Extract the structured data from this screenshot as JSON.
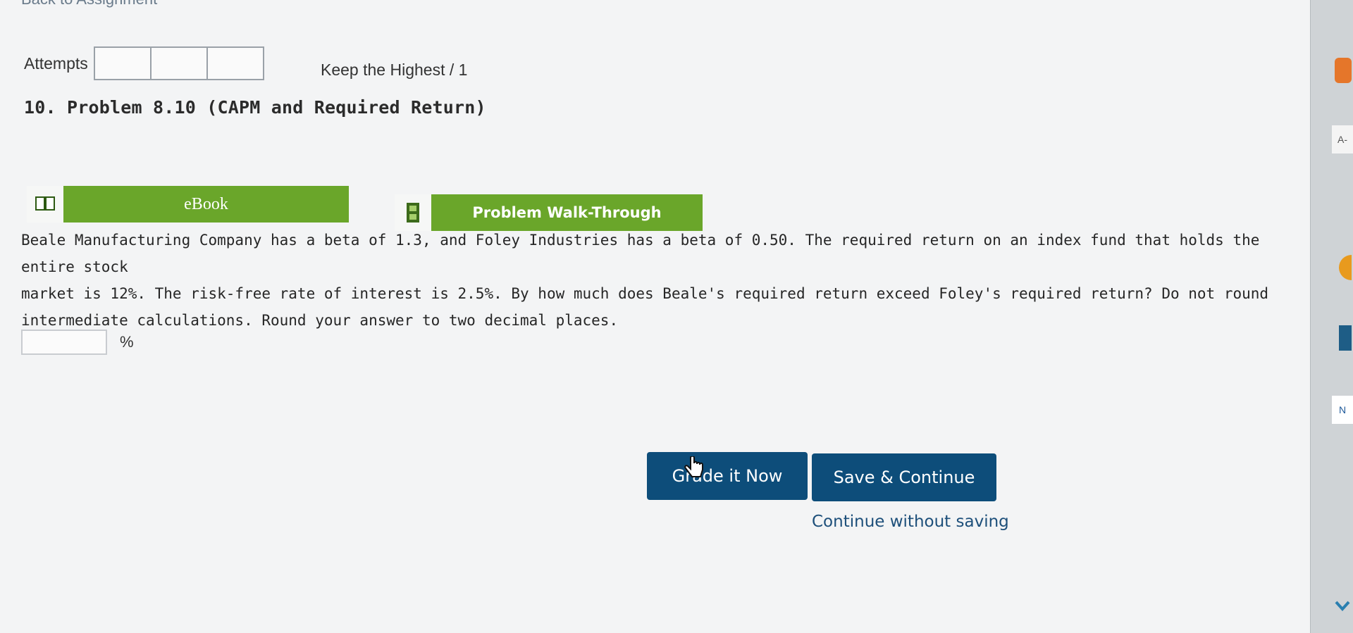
{
  "header": {
    "back_link": "Back to Assignment"
  },
  "attempts": {
    "label": "Attempts",
    "keep_highest": "Keep the Highest / 1"
  },
  "problem": {
    "title": "10. Problem 8.10 (CAPM and Required Return)",
    "tools": {
      "ebook": "eBook",
      "walkthrough": "Problem Walk-Through"
    },
    "question_lines": [
      "Beale Manufacturing Company has a beta of 1.3, and Foley Industries has a beta of 0.50. The required return on an index fund that holds the entire stock",
      "market is 12%. The risk-free rate of interest is 2.5%. By how much does Beale's required return exceed Foley's required return? Do not round",
      "intermediate calculations. Round your answer to two decimal places."
    ],
    "answer": {
      "value": "",
      "unit": "%"
    }
  },
  "actions": {
    "grade": "Grade it Now",
    "save": "Save & Continue",
    "continue_without_saving": "Continue without saving"
  },
  "side_rail": {
    "items": [
      "A-",
      "N"
    ]
  },
  "colors": {
    "accent_green": "#6aa62a",
    "primary_blue": "#0d4d7a",
    "link_blue": "#1d4f7a"
  }
}
